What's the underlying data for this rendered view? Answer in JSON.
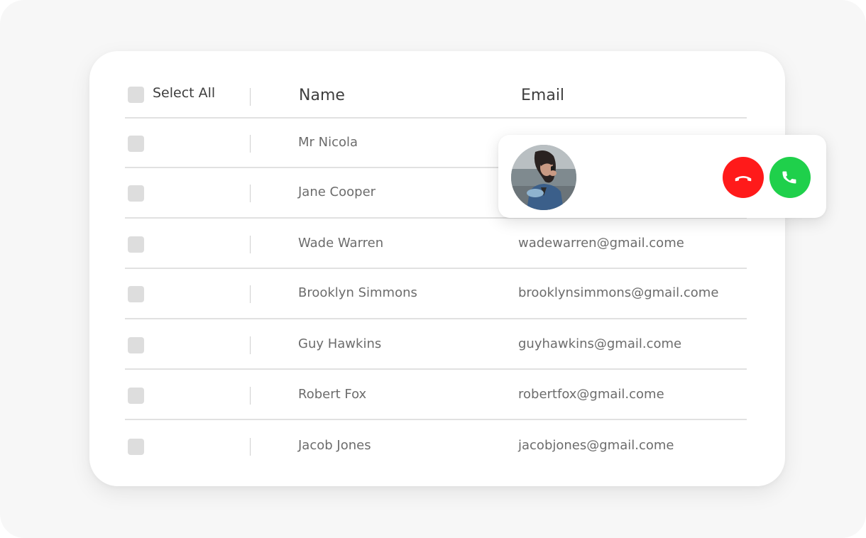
{
  "table": {
    "select_all_label": "Select All",
    "columns": {
      "name": "Name",
      "email": "Email"
    },
    "rows": [
      {
        "name": "Mr Nicola",
        "email": ""
      },
      {
        "name": "Jane Cooper",
        "email": ""
      },
      {
        "name": "Wade Warren",
        "email": "wadewarren@gmail.come"
      },
      {
        "name": "Brooklyn Simmons",
        "email": "brooklynsimmons@gmail.come"
      },
      {
        "name": "Guy Hawkins",
        "email": "guyhawkins@gmail.come"
      },
      {
        "name": "Robert Fox",
        "email": "robertfox@gmail.come"
      },
      {
        "name": "Jacob Jones",
        "email": "jacobjones@gmail.come"
      }
    ]
  },
  "incoming_call": {
    "avatar_icon": "caller-avatar",
    "decline_icon": "hang-up-icon",
    "accept_icon": "phone-icon",
    "colors": {
      "decline": "#ff1a1a",
      "accept": "#1fd04b"
    }
  }
}
